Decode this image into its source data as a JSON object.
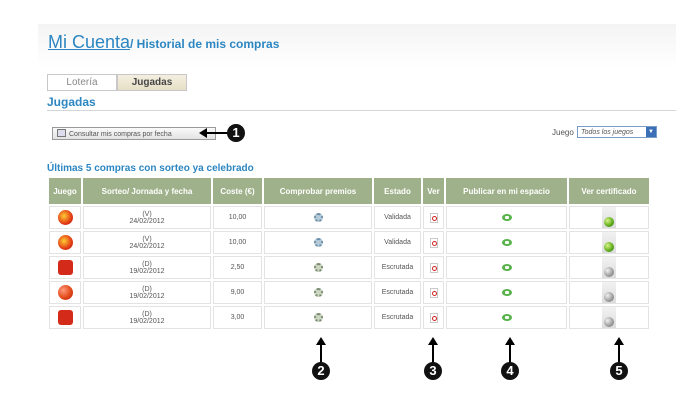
{
  "header": {
    "title_link": "Mi Cuenta",
    "title_rest": "/ Historial de mis compras"
  },
  "tabs": [
    {
      "label": "Lotería"
    },
    {
      "label": "Jugadas"
    }
  ],
  "section_title": "Jugadas",
  "consult_button": {
    "label": "Consultar mis compras por fecha",
    "icon": "calendar-icon"
  },
  "filter": {
    "label": "Juego",
    "selected": "Todos los juegos"
  },
  "table_title": "Últimas 5 compras con sorteo ya celebrado",
  "table": {
    "columns": [
      "Juego",
      "Sorteo/ Jornada y fecha",
      "Coste (€)",
      "Comprobar premios",
      "Estado",
      "Ver",
      "Publicar en mi espacio",
      "Ver certificado"
    ],
    "rows": [
      {
        "game_icon": "game-s-icon",
        "draw_code": "(V)",
        "draw_date": "24/02/2012",
        "cost": "10,00",
        "estado": "Validada",
        "cert": "green"
      },
      {
        "game_icon": "game-s-icon",
        "draw_code": "(V)",
        "draw_date": "24/02/2012",
        "cost": "10,00",
        "estado": "Validada",
        "cert": "green"
      },
      {
        "game_icon": "game-d-icon",
        "draw_code": "(D)",
        "draw_date": "19/02/2012",
        "cost": "2,50",
        "estado": "Escrutada",
        "cert": "grey"
      },
      {
        "game_icon": "game-b-icon",
        "draw_code": "(D)",
        "draw_date": "19/02/2012",
        "cost": "9,00",
        "estado": "Escrutada",
        "cert": "grey"
      },
      {
        "game_icon": "game-d-icon",
        "draw_code": "(D)",
        "draw_date": "19/02/2012",
        "cost": "3,00",
        "estado": "Escrutada",
        "cert": "grey"
      }
    ]
  },
  "annotations": [
    "1",
    "2",
    "3",
    "4",
    "5"
  ],
  "colors": {
    "accent": "#2c86c2",
    "table_header": "#9fb18a"
  }
}
